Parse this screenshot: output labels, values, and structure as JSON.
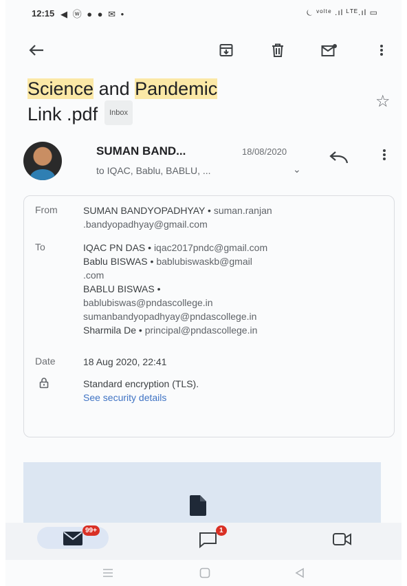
{
  "status_bar": {
    "time": "12:15",
    "left_icons": "◀ ⓦ ● ● ✉ •",
    "right_icons": "⏾ ᵛᵒˡᵗᵉ .ıl ᴸᵀᴱ.ıl ▭"
  },
  "toolbar": {
    "back": "back-arrow-icon",
    "actions": [
      "archive-icon",
      "delete-icon",
      "mark-unread-icon",
      "more-vert-icon"
    ]
  },
  "email": {
    "subject_word1": "Science",
    "subject_word2": " and ",
    "subject_word3": "Pandemic",
    "subject_line2": "Link .pdf",
    "label": "Inbox",
    "sender_short": "SUMAN BAND...",
    "date_short": "18/08/2020",
    "to_summary": "to IQAC, Bablu, BABLU, ...",
    "details": {
      "from_label": "From",
      "from_name": "SUMAN BANDYOPADHYAY",
      "from_email_1": "suman.ranjan",
      "from_email_2": ".bandyopadhyay@gmail.com",
      "to_label": "To",
      "to_1_name": "IQAC PN DAS",
      "to_1_email": "iqac2017pndc@gmail.com",
      "to_2_name": "Bablu BISWAS",
      "to_2_email_1": "bablubiswaskb@gmail",
      "to_2_email_2": ".com",
      "to_3_name": "BABLU BISWAS",
      "to_3_email": "bablubiswas@pndascollege.in",
      "to_4_email": "sumanbandyopadhyay@pndascollege.in",
      "to_5_name": "Sharmila De",
      "to_5_email": "principal@pndascollege.in",
      "date_label": "Date",
      "date_value": "18 Aug 2020, 22:41",
      "security_text": "Standard encryption (TLS).",
      "security_link": "See security details"
    }
  },
  "bottom_nav": {
    "mail_badge": "99+",
    "chat_badge": "1"
  },
  "colors": {
    "highlight": "#fbe8a6",
    "link": "#3f73c4",
    "badge": "#d93025",
    "attachment_bg": "#dce6f2"
  }
}
